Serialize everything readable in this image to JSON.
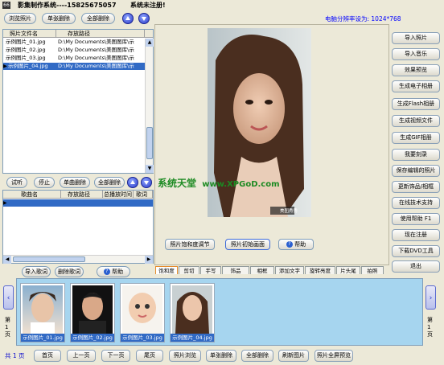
{
  "titlebar": {
    "app_title": "影集制作系统----15825675057",
    "register_status": "系统未注册!"
  },
  "top_toolbar": {
    "browse": "浏览照片",
    "delete_one": "单张删除",
    "delete_all": "全部删除"
  },
  "resolution": "电脑分辨率设为: 1024*768",
  "photo_table": {
    "headers": [
      "照片文件名",
      "存放路径"
    ],
    "rows": [
      {
        "name": "示例图片_01.jpg",
        "path": "D:\\My Documents\\美图图库\\示"
      },
      {
        "name": "示例图片_02.jpg",
        "path": "D:\\My Documents\\美图图库\\示"
      },
      {
        "name": "示例图片_03.jpg",
        "path": "D:\\My Documents\\美图图库\\示"
      },
      {
        "name": "示例图片_04.jpg",
        "path": "D:\\My Documents\\美图图库\\示"
      }
    ]
  },
  "music_toolbar": {
    "listen": "试听",
    "stop": "停止",
    "delete_one": "单曲删除",
    "delete_all": "全部删除"
  },
  "music_table": {
    "headers": [
      "歌曲名",
      "存放路径",
      "总播放时间",
      "歌词"
    ]
  },
  "lyrics_buttons": {
    "import": "导入歌词",
    "delete": "删除歌词",
    "help": "帮助"
  },
  "preview": {
    "watermark_site": "系统天堂",
    "watermark_url": "www.XPGoD.com",
    "photo_badge": "美图秀秀"
  },
  "preview_buttons": {
    "saturation": "照片饱和度调节",
    "initial": "照片初始画面",
    "help": "帮助"
  },
  "tabs": [
    "饱和度",
    "剪切",
    "手写",
    "饰品",
    "相框",
    "添加文字",
    "旋转亮度",
    "片头尾",
    "拍照"
  ],
  "right_buttons": [
    "导入照片",
    "导入音乐",
    "效果预览",
    "生成电子相册",
    "生成Flash相册",
    "生成视频文件",
    "生成GIF相册",
    "我要刻录",
    "保存编辑的照片",
    "更新饰品/相框",
    "在线技术支持",
    "使用帮助 F1",
    "现在注册",
    "下载DVD工具",
    "退出"
  ],
  "thumbnails": [
    "示例图片_01.jpg",
    "示例图片_02.jpg",
    "示例图片_03.jpg",
    "示例图片_04.jpg"
  ],
  "pager": {
    "left_page": "第1页",
    "right_page": "第1页",
    "total": "共 1 页"
  },
  "bottom_buttons": [
    "首页",
    "上一页",
    "下一页",
    "尾页",
    "照片浏览",
    "单张删除",
    "全部删除",
    "刷新图片",
    "照片全屏预览"
  ]
}
